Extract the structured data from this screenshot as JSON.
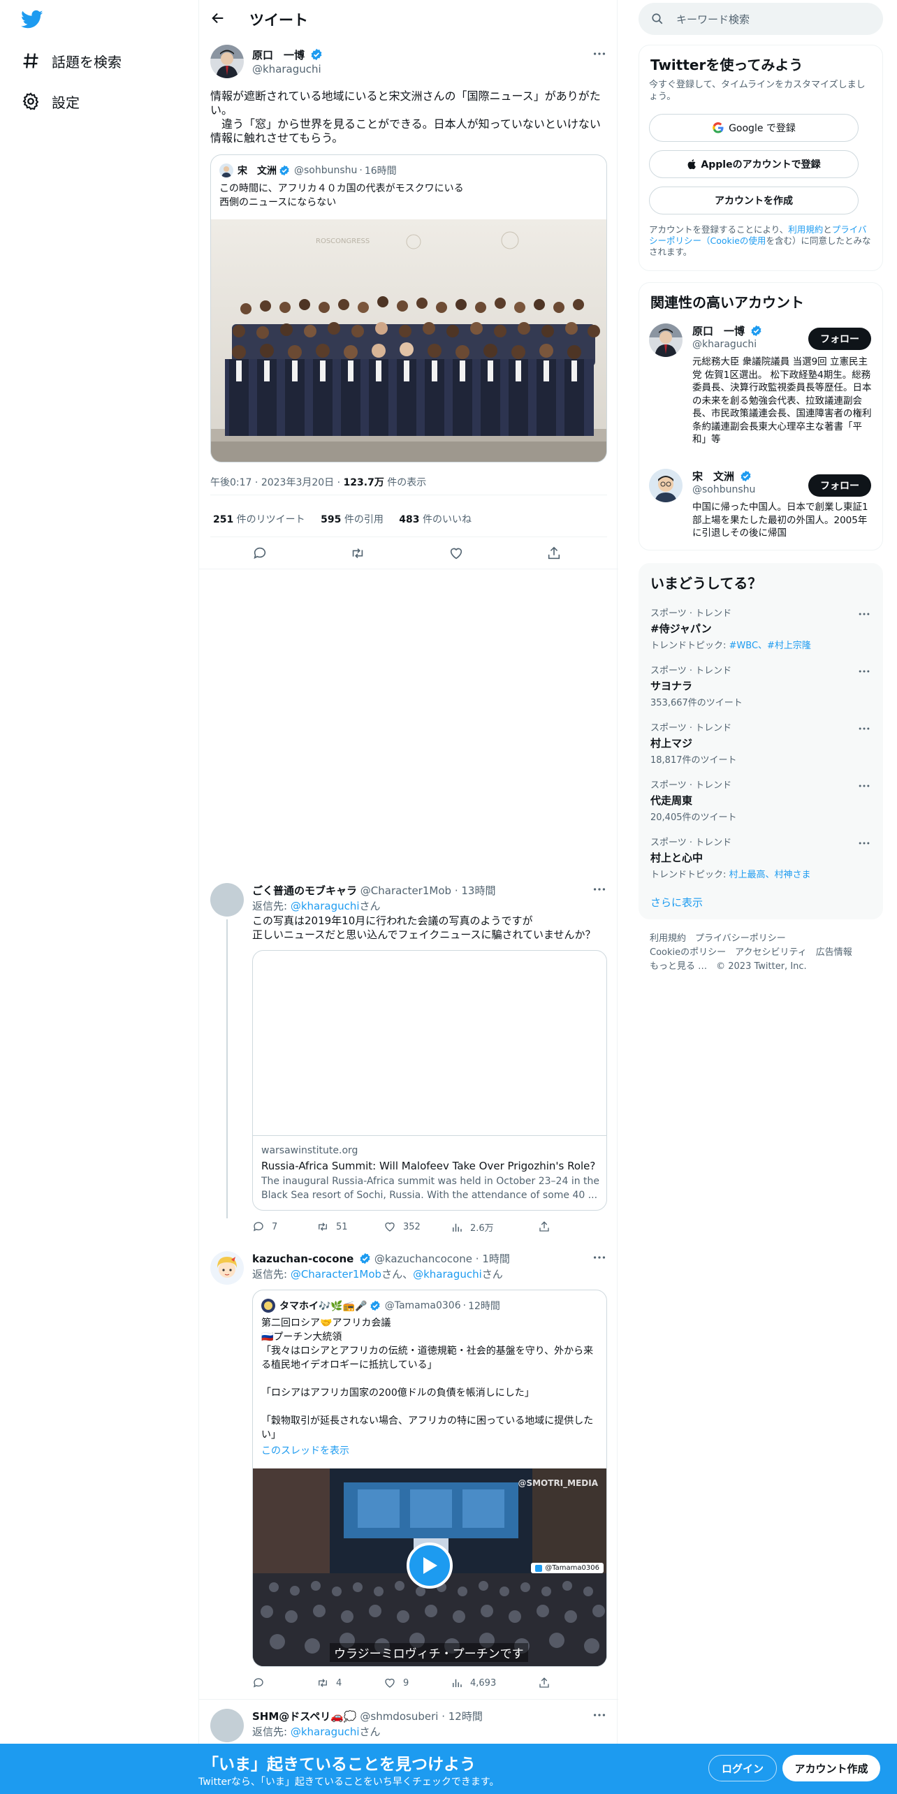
{
  "nav": {
    "explore": "話題を検索",
    "settings": "設定"
  },
  "header": {
    "title": "ツイート"
  },
  "main_tweet": {
    "name": "原口　一博",
    "handle": "@kharaguchi",
    "text": "情報が遮断されている地域にいると宋文洲さんの「国際ニュース」がありがたい。\n　違う「窓」から世界を見ることができる。日本人が知っていないといけない情報に触れさせてもらう。",
    "quote": {
      "name": "宋　文洲",
      "handle": "@sohbunshu",
      "time": "16時間",
      "text": "この時間に、アフリカ４０カ国の代表がモスクワにいる\n西側のニュースにならない"
    },
    "time": "午後0:17",
    "date": "2023年3月20日",
    "views_num": "123.7万",
    "views_label": " 件の表示",
    "retweets_num": "251",
    "retweets_label": " 件のリツイート",
    "quotes_num": "595",
    "quotes_label": " 件の引用",
    "likes_num": "483",
    "likes_label": " 件のいいね"
  },
  "replies": [
    {
      "name": "ごく普通のモブキャラ",
      "handle": "@Character1Mob",
      "time": "13時間",
      "replyto_prefix": "返信先: ",
      "replyto_user": "@kharaguchi",
      "replyto_suffix": "さん",
      "text": "この写真は2019年10月に行われた会議の写真のようですが\n正しいニュースだと思い込んでフェイクニュースに騙されていませんか？",
      "link": {
        "domain": "warsawinstitute.org",
        "title": "Russia-Africa Summit: Will Malofeev Take Over Prigozhin's Role?",
        "desc": "The inaugural Russia-Africa summit was held in October 23–24 in the Black Sea resort of Sochi, Russia. With the attendance of some 40 ..."
      },
      "replies": "7",
      "retweets": "51",
      "likes": "352",
      "views": "2.6万"
    },
    {
      "name": "kazuchan-cocone",
      "handle": "@kazuchancocone",
      "time": "1時間",
      "replyto_prefix": "返信先: ",
      "replyto_user": "@Character1Mob",
      "replyto_mid": "さん、",
      "replyto_user2": "@kharaguchi",
      "replyto_suffix": "さん",
      "quote": {
        "name": "タマホイ🎶🌿📻🎤",
        "handle": "@Tamama0306",
        "time": "12時間",
        "text": "第二回ロシア🤝アフリカ会議\n🇷🇺プーチン大統領\n「我々はロシアとアフリカの伝統・道徳規範・社会的基盤を守り、外から来る植民地イデオロギーに抵抗している」\n\n「ロシアはアフリカ国家の200億ドルの負債を帳消しにした」\n\n「穀物取引が延長されない場合、アフリカの特に困っている地域に提供したい」",
        "thread": "このスレッドを表示",
        "video_caption": "ウラジーミロヴィチ・プーチンです",
        "video_watermark": "@SMOTRI_MEDIA",
        "video_tag": "@Tamama0306"
      },
      "replies": "",
      "retweets": "4",
      "likes": "9",
      "views": "4,693"
    },
    {
      "name": "SHM@ドスペリ🚗💭",
      "handle": "@shmdosuberi",
      "time": "12時間",
      "replyto_prefix": "返信先: ",
      "replyto_user": "@kharaguchi",
      "replyto_suffix": "さん"
    }
  ],
  "sidebar": {
    "search_placeholder": "キーワード検索",
    "signup": {
      "title": "Twitterを使ってみよう",
      "subtitle": "今すぐ登録して、タイムラインをカスタマイズしましょう。",
      "google": "Google で登録",
      "apple": "Appleのアカウントで登録",
      "create": "アカウントを作成",
      "terms_1": "アカウントを登録することにより、",
      "terms_link1": "利用規約",
      "terms_2": "と",
      "terms_link2": "プライバシーポリシー（Cookieの使用",
      "terms_3": "を含む）に同意したとみなされます。"
    },
    "related": {
      "title": "関連性の高いアカウント",
      "follow": "フォロー",
      "accounts": [
        {
          "name": "原口　一博",
          "handle": "@kharaguchi",
          "bio": "元総務大臣 衆議院議員 当選9回 立憲民主党 佐賀1区選出。 松下政経塾4期生。総務委員長、決算行政監視委員長等歴任。日本の未来を創る勉強会代表、拉致議連副会長、市民政策議連会長、国連障害者の権利条約議連副会長東大心理卒主な著書「平和」等"
        },
        {
          "name": "宋　文洲",
          "handle": "@sohbunshu",
          "bio": "中国に帰った中国人。日本で創業し東証1部上場を果たした最初の外国人。2005年に引退しその後に帰国"
        }
      ]
    },
    "trends": {
      "title": "いまどうしてる？",
      "items": [
        {
          "context": "スポーツ · トレンド",
          "name": "#侍ジャパン",
          "topics_label": "トレンドトピック: ",
          "topics": "#WBC、#村上宗隆"
        },
        {
          "context": "スポーツ · トレンド",
          "name": "サヨナラ",
          "count": "353,667件のツイート"
        },
        {
          "context": "スポーツ · トレンド",
          "name": "村上マジ",
          "count": "18,817件のツイート"
        },
        {
          "context": "スポーツ · トレンド",
          "name": "代走周東",
          "count": "20,405件のツイート"
        },
        {
          "context": "スポーツ · トレンド",
          "name": "村上と心中",
          "topics_label": "トレンドトピック: ",
          "topics": "村上最高、村神さま"
        }
      ],
      "show_more": "さらに表示"
    },
    "footer": {
      "line1": "利用規約　プライバシーポリシー",
      "line2": "Cookieのポリシー　アクセシビリティ　広告情報",
      "line3": "もっと見る …　© 2023 Twitter, Inc."
    }
  },
  "banner": {
    "title": "「いま」起きていることを見つけよう",
    "subtitle": "Twitterなら、「いま」起きていることをいち早くチェックできます。",
    "login": "ログイン",
    "signup": "アカウント作成"
  }
}
